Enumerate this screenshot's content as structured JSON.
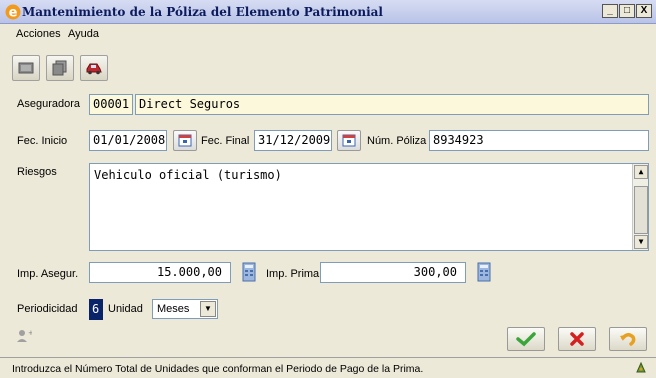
{
  "window": {
    "title": "Mantenimiento de la Póliza del Elemento Patrimonial",
    "min": "_",
    "max": "□",
    "close": "X"
  },
  "menu": {
    "acciones": "Acciones",
    "ayuda": "Ayuda"
  },
  "form": {
    "aseguradora_label": "Aseguradora",
    "aseguradora_code": "00001",
    "aseguradora_name": "Direct Seguros",
    "fec_inicio_label": "Fec. Inicio",
    "fec_inicio_value": "01/01/2008",
    "fec_final_label": "Fec. Final",
    "fec_final_value": "31/12/2009",
    "num_poliza_label": "Núm. Póliza",
    "num_poliza_value": "8934923",
    "riesgos_label": "Riesgos",
    "riesgos_value": "Vehiculo oficial (turismo)",
    "imp_asegur_label": "Imp. Asegur.",
    "imp_asegur_value": "15.000,00",
    "imp_prima_label": "Imp. Prima",
    "imp_prima_value": "300,00",
    "periodicidad_label": "Periodicidad",
    "periodicidad_value": "6",
    "unidad_label": "Unidad",
    "unidad_value": "Meses"
  },
  "status": {
    "text": "Introduzca el Número Total de Unidades que conforman el Periodo de Pago de la Prima."
  },
  "colors": {
    "accept": "#3aa53a",
    "cancel": "#d42020",
    "undo": "#e8a020"
  }
}
